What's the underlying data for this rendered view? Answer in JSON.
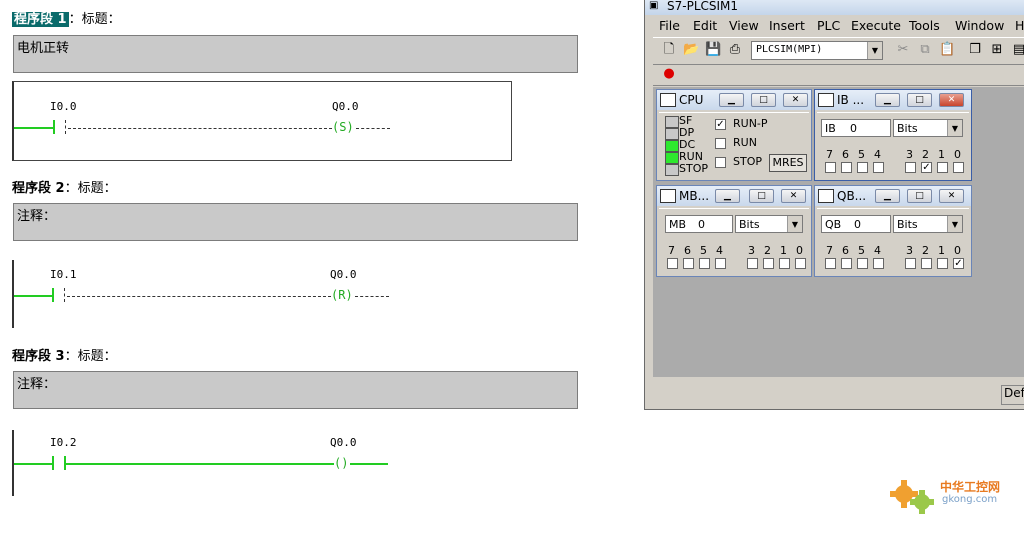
{
  "editor": {
    "networks": [
      {
        "prefix": "程序段 1",
        "suffix": "：标题：",
        "comment": "电机正转",
        "contact": "I0.0",
        "coil_addr": "Q0.0",
        "coil_symbol": "(S)"
      },
      {
        "prefix": "程序段 2",
        "suffix": "：标题：",
        "comment": "注释：",
        "contact": "I0.1",
        "coil_addr": "Q0.0",
        "coil_symbol": "(R)"
      },
      {
        "prefix": "程序段 3",
        "suffix": "：标题：",
        "comment": "注释：",
        "contact": "I0.2",
        "coil_addr": "Q0.0",
        "coil_symbol": "()"
      }
    ]
  },
  "plcsim": {
    "title": "S7-PLCSIM1",
    "menu": [
      "File",
      "Edit",
      "View",
      "Insert",
      "PLC",
      "Execute",
      "Tools",
      "Window",
      "H"
    ],
    "connection": "PLCSIM(MPI)",
    "status_cell": "Def",
    "cpu": {
      "title": "CPU",
      "leds": [
        {
          "label": "SF",
          "on": false
        },
        {
          "label": "DP",
          "on": false
        },
        {
          "label": "DC",
          "on": true
        },
        {
          "label": "RUN",
          "on": true
        },
        {
          "label": "STOP",
          "on": false
        }
      ],
      "modes": [
        {
          "label": "RUN-P",
          "checked": true
        },
        {
          "label": "RUN",
          "checked": false
        },
        {
          "label": "STOP",
          "checked": false
        }
      ],
      "mres": "MRES"
    },
    "ib": {
      "title": "IB ...",
      "address": "IB",
      "offset": "0",
      "format": "Bits",
      "bits": [
        0,
        0,
        0,
        0,
        0,
        1,
        0,
        0
      ]
    },
    "mb": {
      "title": "MB...",
      "address": "MB",
      "offset": "0",
      "format": "Bits",
      "bits": [
        0,
        0,
        0,
        0,
        0,
        0,
        0,
        0
      ]
    },
    "qb": {
      "title": "QB...",
      "address": "QB",
      "offset": "0",
      "format": "Bits",
      "bits": [
        0,
        0,
        0,
        0,
        0,
        0,
        0,
        1
      ]
    },
    "bit_labels": [
      "7",
      "6",
      "5",
      "4",
      "3",
      "2",
      "1",
      "0"
    ]
  },
  "watermark": {
    "text1": "中华工控网",
    "text2": "gkong.com"
  }
}
